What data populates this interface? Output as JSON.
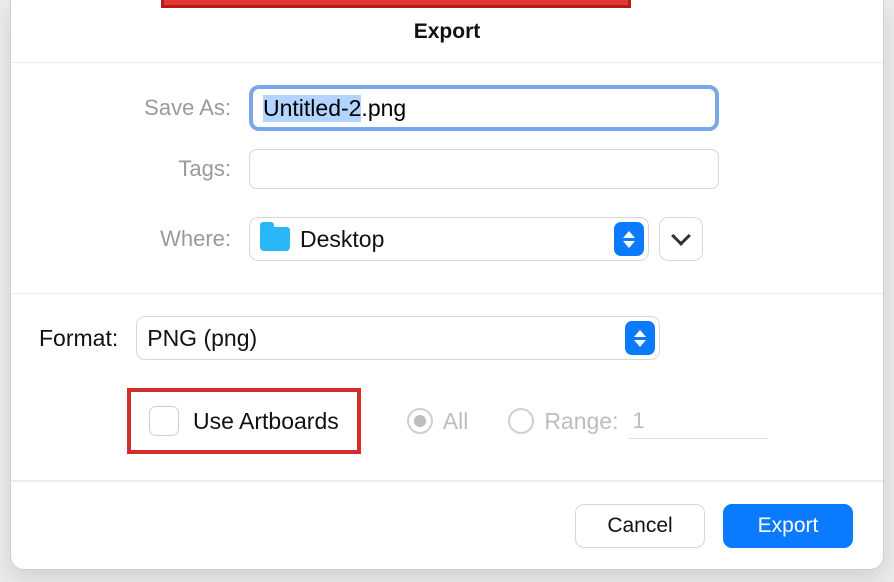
{
  "title": "Export",
  "fields": {
    "save_as_label": "Save As:",
    "save_as_value": "Untitled-2.png",
    "tags_label": "Tags:",
    "tags_value": "",
    "where_label": "Where:",
    "where_value": "Desktop"
  },
  "format": {
    "label": "Format:",
    "value": "PNG (png)"
  },
  "options": {
    "use_artboards_label": "Use Artboards",
    "use_artboards_checked": false,
    "all_label": "All",
    "all_selected": true,
    "range_label": "Range:",
    "range_value": "1"
  },
  "buttons": {
    "cancel": "Cancel",
    "export": "Export"
  },
  "icons": {
    "folder": "folder-icon",
    "stepper": "up-down-stepper",
    "expand": "chevron-down-icon"
  },
  "colors": {
    "accent": "#0a7aff",
    "highlight_red": "#d32f2f",
    "focus_ring": "#7aa7e9"
  }
}
